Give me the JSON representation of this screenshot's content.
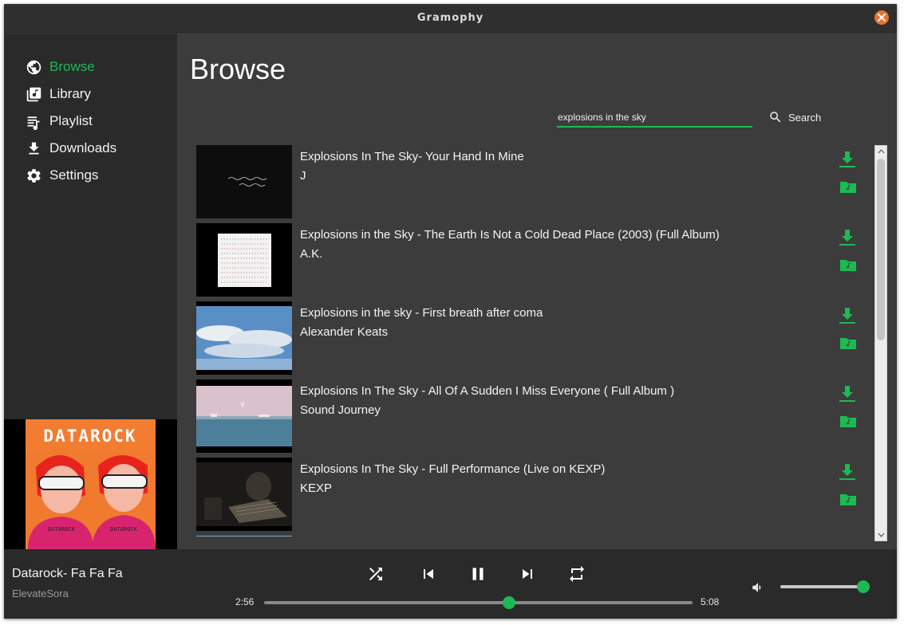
{
  "window": {
    "title": "Gramophy"
  },
  "sidebar": {
    "items": [
      {
        "label": "Browse",
        "icon": "globe-icon",
        "active": true
      },
      {
        "label": "Library",
        "icon": "library-music-icon",
        "active": false
      },
      {
        "label": "Playlist",
        "icon": "playlist-icon",
        "active": false
      },
      {
        "label": "Downloads",
        "icon": "download-icon",
        "active": false
      },
      {
        "label": "Settings",
        "icon": "settings-cog-icon",
        "active": false
      }
    ],
    "cover_art": {
      "text": "DATAROCK",
      "band_label": "DATAROCK"
    }
  },
  "main": {
    "title": "Browse",
    "search": {
      "value": "explosions in the sky",
      "button_label": "Search"
    },
    "results": [
      {
        "title": "Explosions In The Sky- Your Hand In Mine",
        "artist": "J"
      },
      {
        "title": "Explosions in the Sky - The Earth Is Not a Cold Dead Place (2003) (Full Album)",
        "artist": "A.K."
      },
      {
        "title": "Explosions in the sky - First breath after coma",
        "artist": "Alexander Keats"
      },
      {
        "title": "Explosions In The Sky - All Of A Sudden I Miss Everyone ( Full Album )",
        "artist": "Sound Journey"
      },
      {
        "title": "Explosions In The Sky - Full Performance (Live on KEXP)",
        "artist": "KEXP"
      }
    ]
  },
  "player": {
    "track_title": "Datarock- Fa Fa Fa",
    "track_artist": "ElevateSora",
    "elapsed": "2:56",
    "duration": "5:08",
    "progress_fraction": 0.571,
    "volume_fraction": 1.0,
    "state": "playing"
  },
  "colors": {
    "accent": "#1db954",
    "close_button": "#e9722c",
    "sidebar_bg": "#2a2a2a",
    "main_bg": "#3c3c3c"
  }
}
